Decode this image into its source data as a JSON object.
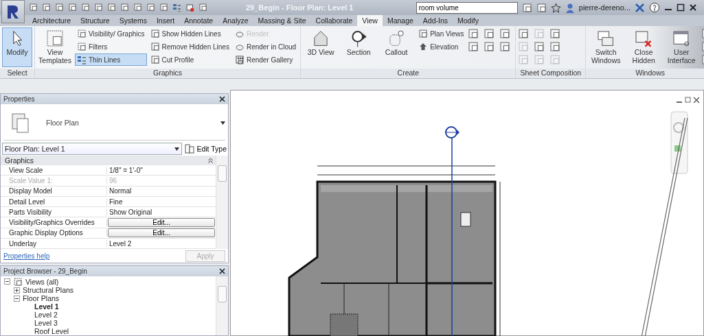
{
  "window": {
    "title": "29_Begin - Floor Plan: Level 1"
  },
  "search": {
    "value": "room volume"
  },
  "user": {
    "name": "pierre-dereno..."
  },
  "ribbon_tabs": [
    {
      "label": "Architecture",
      "selected": false
    },
    {
      "label": "Structure",
      "selected": false
    },
    {
      "label": "Systems",
      "selected": false
    },
    {
      "label": "Insert",
      "selected": false
    },
    {
      "label": "Annotate",
      "selected": false
    },
    {
      "label": "Analyze",
      "selected": false
    },
    {
      "label": "Massing & Site",
      "selected": false
    },
    {
      "label": "Collaborate",
      "selected": false
    },
    {
      "label": "View",
      "selected": true
    },
    {
      "label": "Manage",
      "selected": false
    },
    {
      "label": "Add-Ins",
      "selected": false
    },
    {
      "label": "Modify",
      "selected": false
    }
  ],
  "ribbon_panels": [
    {
      "title": "Select",
      "tools": [
        {
          "label": "Modify",
          "kind": "large",
          "active": true,
          "disabled": false
        }
      ]
    },
    {
      "title": "Graphics",
      "tools": [
        {
          "label": "View Templates",
          "kind": "large",
          "active": false,
          "disabled": false
        },
        {
          "label": "Visibility/ Graphics",
          "kind": "small",
          "active": false,
          "disabled": false
        },
        {
          "label": "Filters",
          "kind": "small",
          "active": false,
          "disabled": false
        },
        {
          "label": "Thin Lines",
          "kind": "small",
          "active": true,
          "disabled": false
        },
        {
          "label": "Show Hidden Lines",
          "kind": "small",
          "active": false,
          "disabled": false
        },
        {
          "label": "Remove Hidden Lines",
          "kind": "small",
          "active": false,
          "disabled": false
        },
        {
          "label": "Cut Profile",
          "kind": "small",
          "active": false,
          "disabled": false
        },
        {
          "label": "Render",
          "kind": "small",
          "active": false,
          "disabled": true
        },
        {
          "label": "Render in Cloud",
          "kind": "small",
          "active": false,
          "disabled": false
        },
        {
          "label": "Render Gallery",
          "kind": "small",
          "active": false,
          "disabled": false
        }
      ]
    },
    {
      "title": "Create",
      "tools": [
        {
          "label": "3D View",
          "kind": "large",
          "active": false,
          "disabled": false
        },
        {
          "label": "Section",
          "kind": "large",
          "active": false,
          "disabled": false
        },
        {
          "label": "Callout",
          "kind": "large",
          "active": false,
          "disabled": false
        },
        {
          "label": "Plan Views",
          "kind": "small",
          "active": false,
          "disabled": false
        },
        {
          "label": "Elevation",
          "kind": "small",
          "active": false,
          "disabled": false
        }
      ]
    },
    {
      "title": "Sheet Composition"
    },
    {
      "title": "Windows",
      "tools": [
        {
          "label": "Switch Windows",
          "kind": "large",
          "active": false,
          "disabled": false
        },
        {
          "label": "Close Hidden",
          "kind": "large",
          "active": false,
          "disabled": false
        },
        {
          "label": "User Interface",
          "kind": "large",
          "active": false,
          "disabled": false
        }
      ]
    }
  ],
  "properties": {
    "title": "Properties",
    "type_name": "Floor Plan",
    "selector": "Floor Plan: Level 1",
    "edit_type": "Edit Type",
    "group": "Graphics",
    "rows": [
      {
        "name": "View Scale",
        "value": "1/8\" = 1'-0\"",
        "kind": "text",
        "disabled": false
      },
      {
        "name": "Scale Value    1:",
        "value": "96",
        "kind": "text",
        "disabled": true
      },
      {
        "name": "Display Model",
        "value": "Normal",
        "kind": "text",
        "disabled": false
      },
      {
        "name": "Detail Level",
        "value": "Fine",
        "kind": "text",
        "disabled": false
      },
      {
        "name": "Parts Visibility",
        "value": "Show Original",
        "kind": "text",
        "disabled": false
      },
      {
        "name": "Visibility/Graphics Overrides",
        "value": "Edit...",
        "kind": "button",
        "disabled": false
      },
      {
        "name": "Graphic Display Options",
        "value": "Edit...",
        "kind": "button",
        "disabled": false
      },
      {
        "name": "Underlay",
        "value": "Level 2",
        "kind": "text",
        "disabled": false
      }
    ],
    "help": "Properties help",
    "apply": {
      "label": "Apply",
      "disabled": true
    }
  },
  "project_browser": {
    "title": "Project Browser - 29_Begin",
    "tree": [
      {
        "label": "Views (all)",
        "expanded": true,
        "selected": false,
        "children": [
          {
            "label": "Structural Plans",
            "expanded": false,
            "selected": false
          },
          {
            "label": "Floor Plans",
            "expanded": true,
            "selected": false,
            "children": [
              {
                "label": "Level 1",
                "selected": true
              },
              {
                "label": "Level 2",
                "selected": false
              },
              {
                "label": "Level 3",
                "selected": false
              },
              {
                "label": "Roof Level",
                "selected": false
              }
            ]
          }
        ]
      }
    ]
  }
}
